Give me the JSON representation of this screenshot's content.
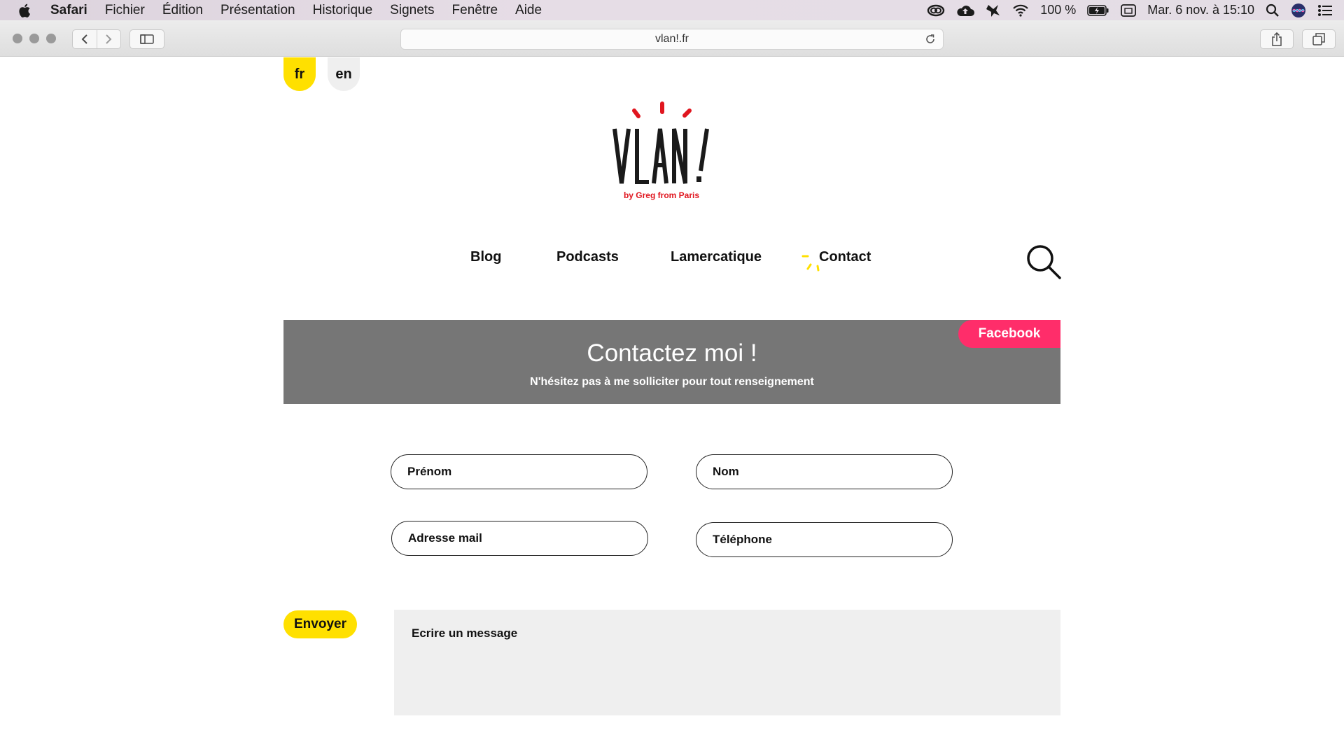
{
  "menubar": {
    "app": "Safari",
    "items": [
      "Fichier",
      "Édition",
      "Présentation",
      "Historique",
      "Signets",
      "Fenêtre",
      "Aide"
    ],
    "battery": "100 %",
    "datetime": "Mar. 6 nov. à  15:10"
  },
  "browser": {
    "url": "vlan!.fr"
  },
  "lang": {
    "fr": "fr",
    "en": "en"
  },
  "logo": {
    "subtitle": "by Greg from Paris"
  },
  "nav": {
    "blog": "Blog",
    "podcasts": "Podcasts",
    "lamercatique": "Lamercatique",
    "contact": "Contact"
  },
  "banner": {
    "title": "Contactez moi !",
    "subtitle": "N'hésitez pas à me solliciter pour tout renseignement",
    "facebook": "Facebook"
  },
  "form": {
    "prenom": "Prénom",
    "nom": "Nom",
    "mail": "Adresse mail",
    "telephone": "Téléphone",
    "message": "Ecrire un message",
    "send": "Envoyer"
  },
  "colors": {
    "yellow": "#ffe000",
    "facebook": "#ff2d6a",
    "banner": "#767676",
    "logo_red": "#e0161f"
  }
}
